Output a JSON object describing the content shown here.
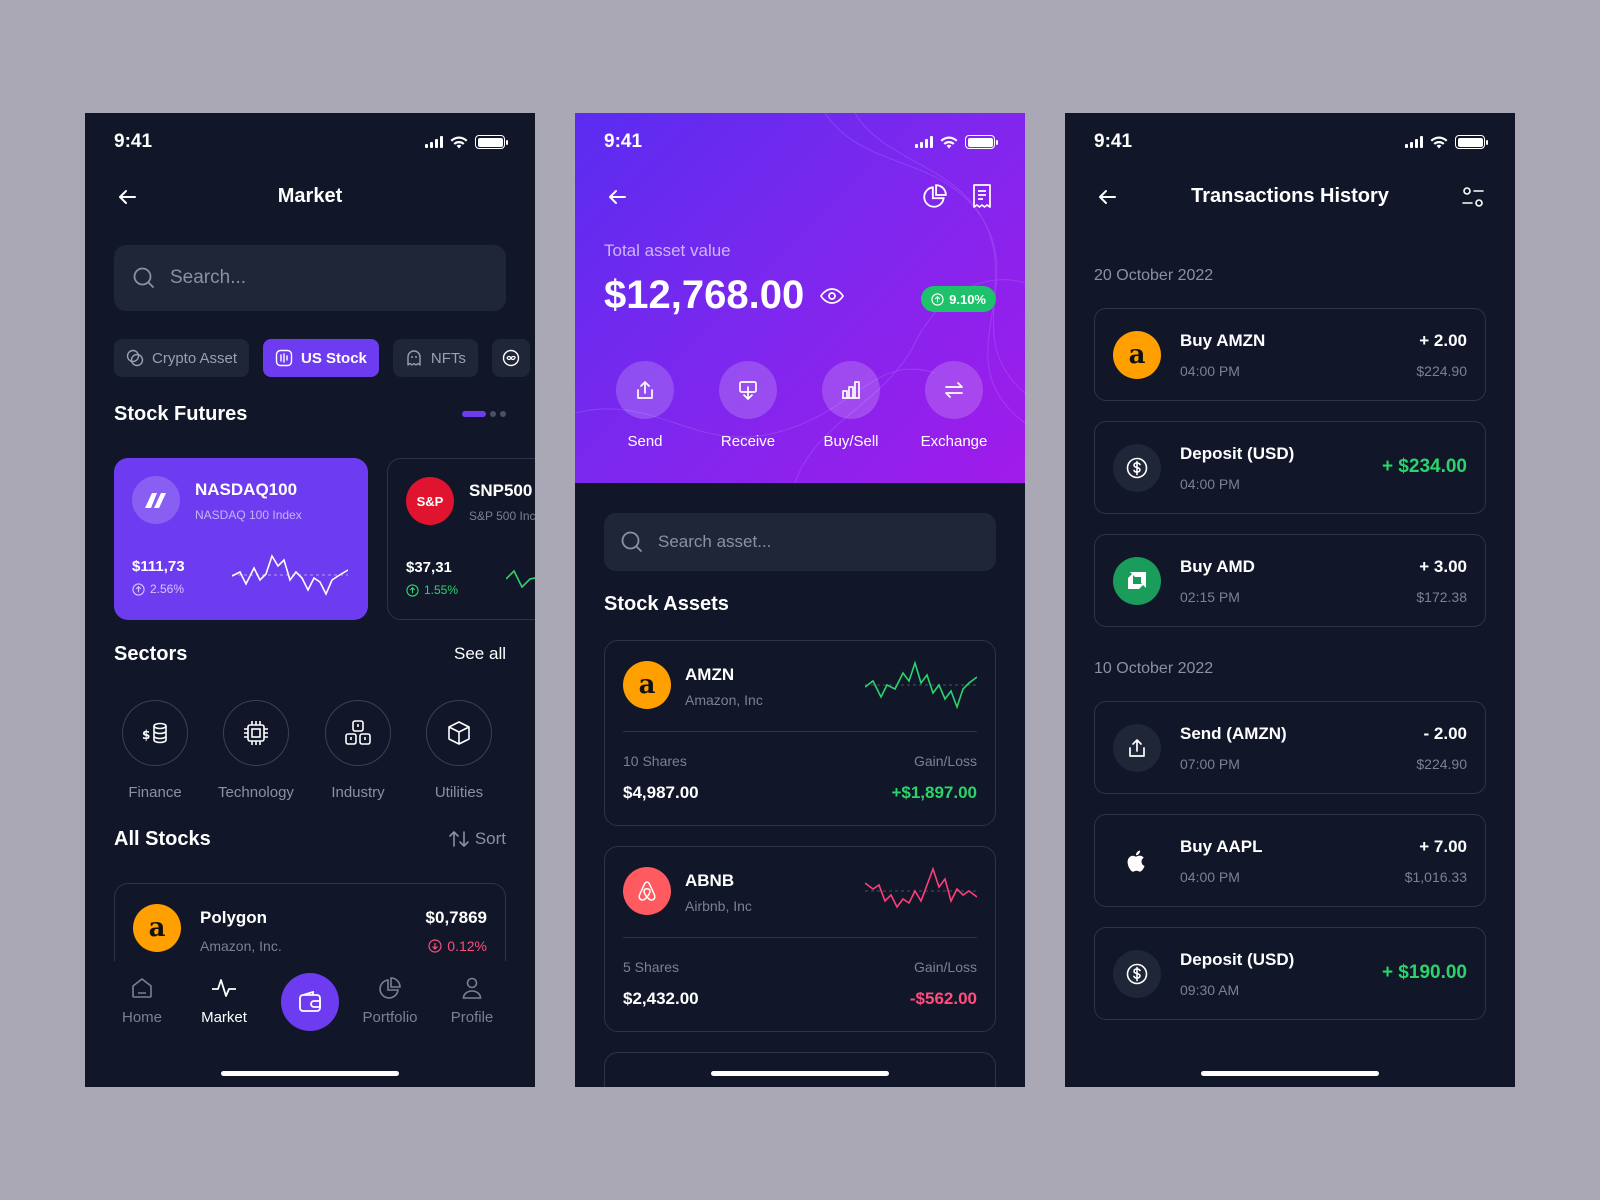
{
  "status": {
    "time": "9:41"
  },
  "market": {
    "title": "Market",
    "search_placeholder": "Search...",
    "chips": [
      "Crypto Asset",
      "US Stock",
      "NFTs"
    ],
    "futures_title": "Stock Futures",
    "futures": [
      {
        "ticker": "NASDAQ100",
        "name": "NASDAQ 100 Index",
        "price": "$111,73",
        "change": "2.56%"
      },
      {
        "ticker": "SNP500",
        "name": "S&P 500 Inc",
        "price": "$37,31",
        "change": "1.55%",
        "logo": "S&P"
      }
    ],
    "sectors_title": "Sectors",
    "see_all": "See all",
    "sectors": [
      "Finance",
      "Technology",
      "Industry",
      "Utilities"
    ],
    "all_stocks_title": "All Stocks",
    "sort": "Sort",
    "stock": {
      "name": "Polygon",
      "company": "Amazon, Inc.",
      "price": "$0,7869",
      "change": "0.12%"
    },
    "nav": [
      "Home",
      "Market",
      "Portfolio",
      "Profile"
    ]
  },
  "portfolio": {
    "total_label": "Total asset value",
    "total_value": "$12,768.00",
    "badge": "9.10%",
    "actions": [
      "Send",
      "Receive",
      "Buy/Sell",
      "Exchange"
    ],
    "search_placeholder": "Search asset...",
    "assets_title": "Stock Assets",
    "assets": [
      {
        "ticker": "AMZN",
        "name": "Amazon, Inc",
        "shares": "10 Shares",
        "gain_label": "Gain/Loss",
        "value": "$4,987.00",
        "gain": "+$1,897.00"
      },
      {
        "ticker": "ABNB",
        "name": "Airbnb, Inc",
        "shares": "5 Shares",
        "gain_label": "Gain/Loss",
        "value": "$2,432.00",
        "gain": "-$562.00"
      }
    ]
  },
  "history": {
    "title": "Transactions History",
    "groups": [
      {
        "date": "20 October 2022",
        "items": [
          {
            "name": "Buy AMZN",
            "time": "04:00 PM",
            "amount": "+ 2.00",
            "price": "$224.90",
            "logo": "amazon-icon"
          },
          {
            "name": "Deposit (USD)",
            "time": "04:00 PM",
            "amount": "+ $234.00",
            "price": "",
            "logo": "dollar-icon"
          },
          {
            "name": "Buy AMD",
            "time": "02:15 PM",
            "amount": "+ 3.00",
            "price": "$172.38",
            "logo": "amd-icon"
          }
        ]
      },
      {
        "date": "10 October 2022",
        "items": [
          {
            "name": "Send (AMZN)",
            "time": "07:00 PM",
            "amount": "- 2.00",
            "price": "$224.90",
            "logo": "send-icon"
          },
          {
            "name": "Buy AAPL",
            "time": "04:00 PM",
            "amount": "+ 7.00",
            "price": "$1,016.33",
            "logo": "apple-icon"
          },
          {
            "name": "Deposit (USD)",
            "time": "09:30 AM",
            "amount": "+ $190.00",
            "price": "",
            "logo": "dollar-icon"
          }
        ]
      }
    ]
  },
  "colors": {
    "accent": "#6e3cf0",
    "bg": "#111729",
    "positive": "#2bd46a",
    "negative": "#ff4d7d"
  }
}
